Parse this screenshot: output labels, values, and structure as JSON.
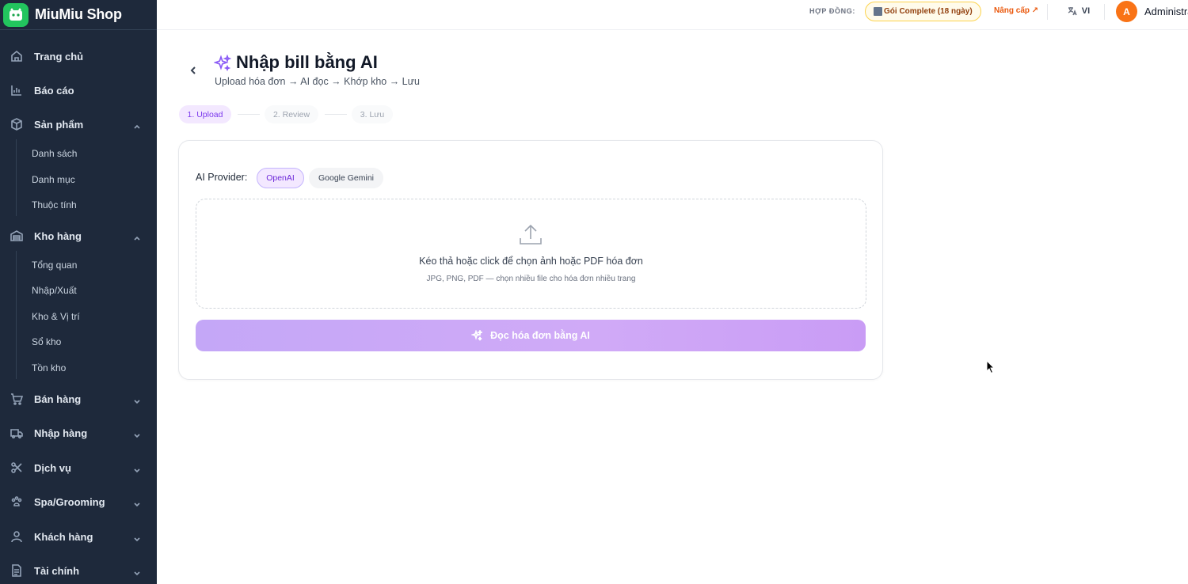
{
  "brand": {
    "name": "MiuMiu Shop"
  },
  "sidebar": {
    "items": [
      {
        "label": "Trang chủ",
        "icon": "home-icon"
      },
      {
        "label": "Báo cáo",
        "icon": "chart-icon"
      },
      {
        "label": "Sản phẩm",
        "icon": "box-icon",
        "expanded": true,
        "children": [
          "Danh sách",
          "Danh mục",
          "Thuộc tính"
        ]
      },
      {
        "label": "Kho hàng",
        "icon": "warehouse-icon",
        "expanded": true,
        "children": [
          "Tổng quan",
          "Nhập/Xuất",
          "Kho & Vị trí",
          "Sổ kho",
          "Tồn kho"
        ]
      },
      {
        "label": "Bán hàng",
        "icon": "cart-icon",
        "expanded": false
      },
      {
        "label": "Nhập hàng",
        "icon": "truck-icon",
        "expanded": false
      },
      {
        "label": "Dịch vụ",
        "icon": "scissors-icon",
        "expanded": false
      },
      {
        "label": "Spa/Grooming",
        "icon": "paw-icon",
        "expanded": false
      },
      {
        "label": "Khách hàng",
        "icon": "user-icon",
        "expanded": false
      },
      {
        "label": "Tài chính",
        "icon": "document-icon",
        "expanded": false
      }
    ]
  },
  "topbar": {
    "contract_label": "HỢP ĐỒNG:",
    "plan": "Gói Complete (18 ngày)",
    "upgrade": "Nâng cấp ↗",
    "language": "VI",
    "avatar_initial": "A",
    "user_name": "Administrator"
  },
  "page": {
    "title": "Nhập bill bằng AI",
    "subtitle": "Upload hóa đơn → AI đọc → Khớp kho → Lưu",
    "steps": [
      "1. Upload",
      "2. Review",
      "3. Lưu"
    ],
    "active_step": 0
  },
  "card": {
    "provider_label": "AI Provider:",
    "providers": [
      "OpenAI",
      "Google Gemini"
    ],
    "selected_provider": "OpenAI",
    "dropzone_main": "Kéo thả hoặc click để chọn ảnh hoặc PDF hóa đơn",
    "dropzone_sub": "JPG, PNG, PDF — chọn nhiều file cho hóa đơn nhiều trang",
    "ai_button": "Đọc hóa đơn bằng AI"
  },
  "colors": {
    "sidebar_bg": "#1e293b",
    "accent": "#8b5cf6",
    "avatar": "#f97316",
    "upgrade": "#ea580c"
  }
}
